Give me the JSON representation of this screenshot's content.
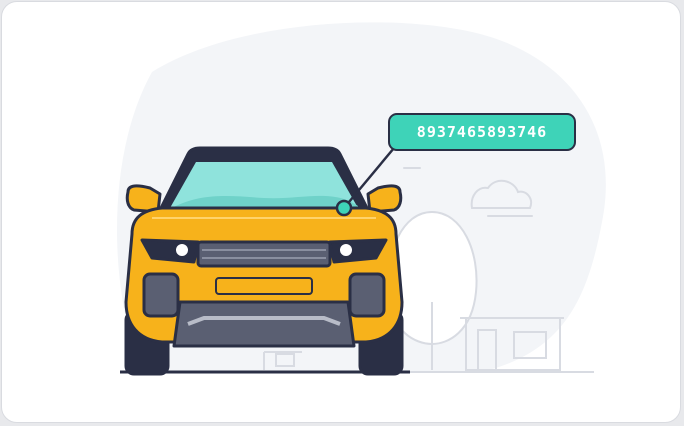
{
  "vin_callout": {
    "number": "8937465893746"
  },
  "colors": {
    "car_body": "#f7b21b",
    "outline": "#2a2f45",
    "accent_teal": "#3ed3b8",
    "windshield": "#8fe3dc",
    "background_blob": "#f3f5f8",
    "scenery_lines": "#d8dbe2"
  },
  "scene": {
    "subject": "car-front-icon",
    "background_elements": [
      "cloud-icon",
      "tree-icon",
      "house-icon"
    ]
  }
}
